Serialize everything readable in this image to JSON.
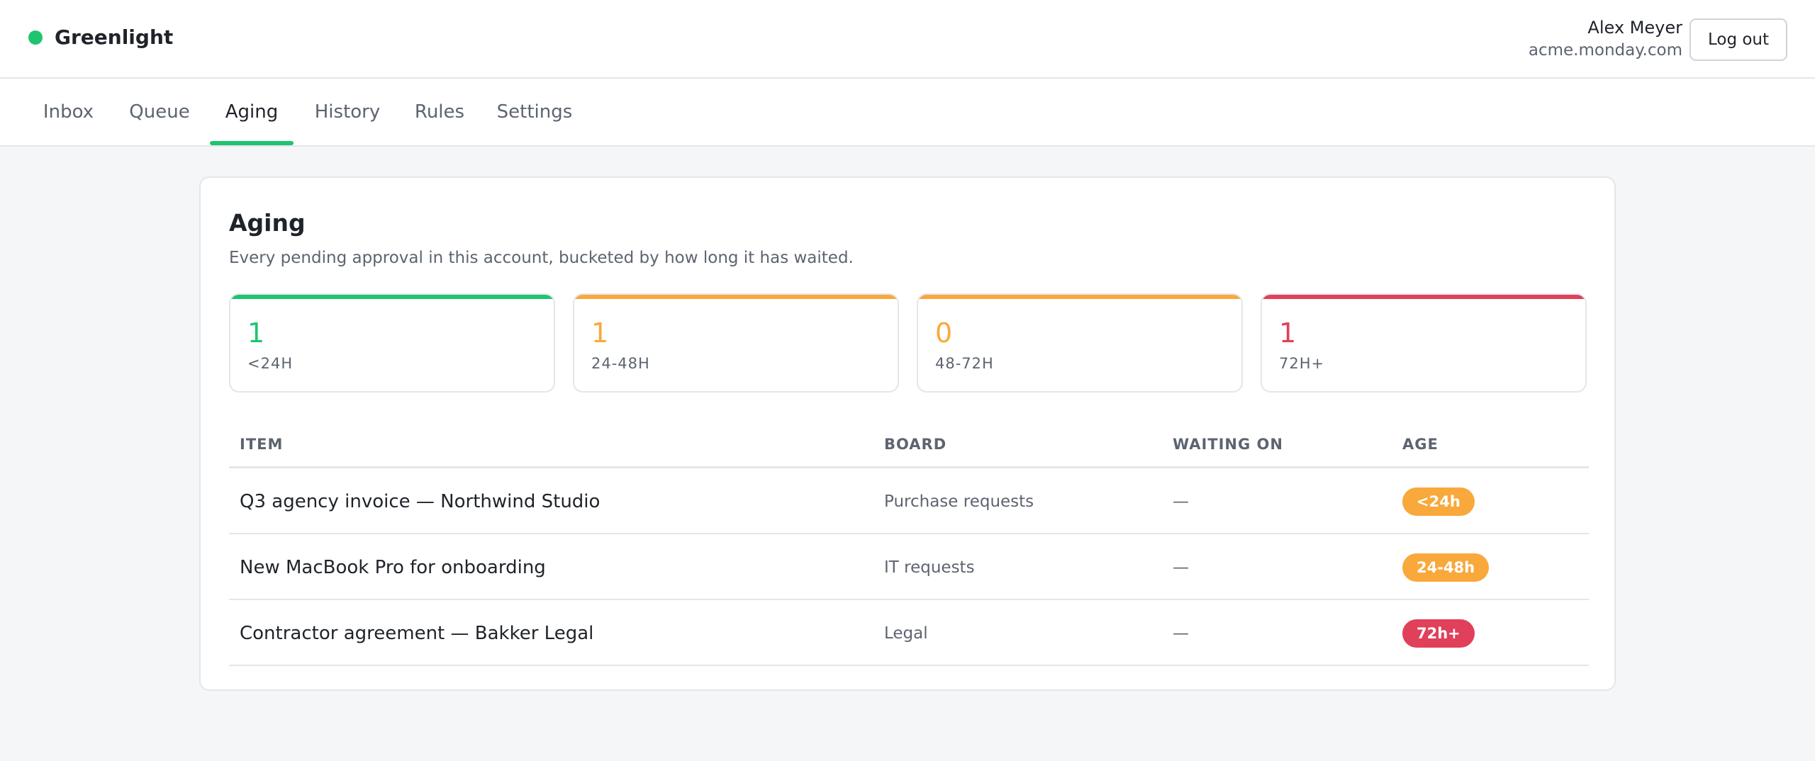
{
  "header": {
    "brand": "Greenlight",
    "brand_color": "#1fc46f",
    "user_name": "Alex Meyer",
    "account": "acme.monday.com",
    "logout_label": "Log out"
  },
  "nav": {
    "tabs": [
      {
        "label": "Inbox",
        "active": false
      },
      {
        "label": "Queue",
        "active": false
      },
      {
        "label": "Aging",
        "active": true
      },
      {
        "label": "History",
        "active": false
      },
      {
        "label": "Rules",
        "active": false
      },
      {
        "label": "Settings",
        "active": false
      }
    ]
  },
  "aging": {
    "title": "Aging",
    "description": "Every pending approval in this account, bucketed by how long it has waited.",
    "buckets": [
      {
        "count": "1",
        "label": "<24H",
        "color": "#1fc46f"
      },
      {
        "count": "1",
        "label": "24-48H",
        "color": "#f9a83c"
      },
      {
        "count": "0",
        "label": "48-72H",
        "color": "#f9a83c"
      },
      {
        "count": "1",
        "label": "72H+",
        "color": "#e0405a"
      }
    ],
    "table": {
      "headers": {
        "item": "ITEM",
        "board": "BOARD",
        "waiting_on": "WAITING ON",
        "age": "AGE"
      },
      "rows": [
        {
          "item": "Q3 agency invoice — Northwind Studio",
          "board": "Purchase requests",
          "waiting_on": "—",
          "age": "<24h",
          "age_color": "#f9a83c"
        },
        {
          "item": "New MacBook Pro for onboarding",
          "board": "IT requests",
          "waiting_on": "—",
          "age": "24-48h",
          "age_color": "#f9a83c"
        },
        {
          "item": "Contractor agreement — Bakker Legal",
          "board": "Legal",
          "waiting_on": "—",
          "age": "72h+",
          "age_color": "#e0405a"
        }
      ]
    }
  }
}
